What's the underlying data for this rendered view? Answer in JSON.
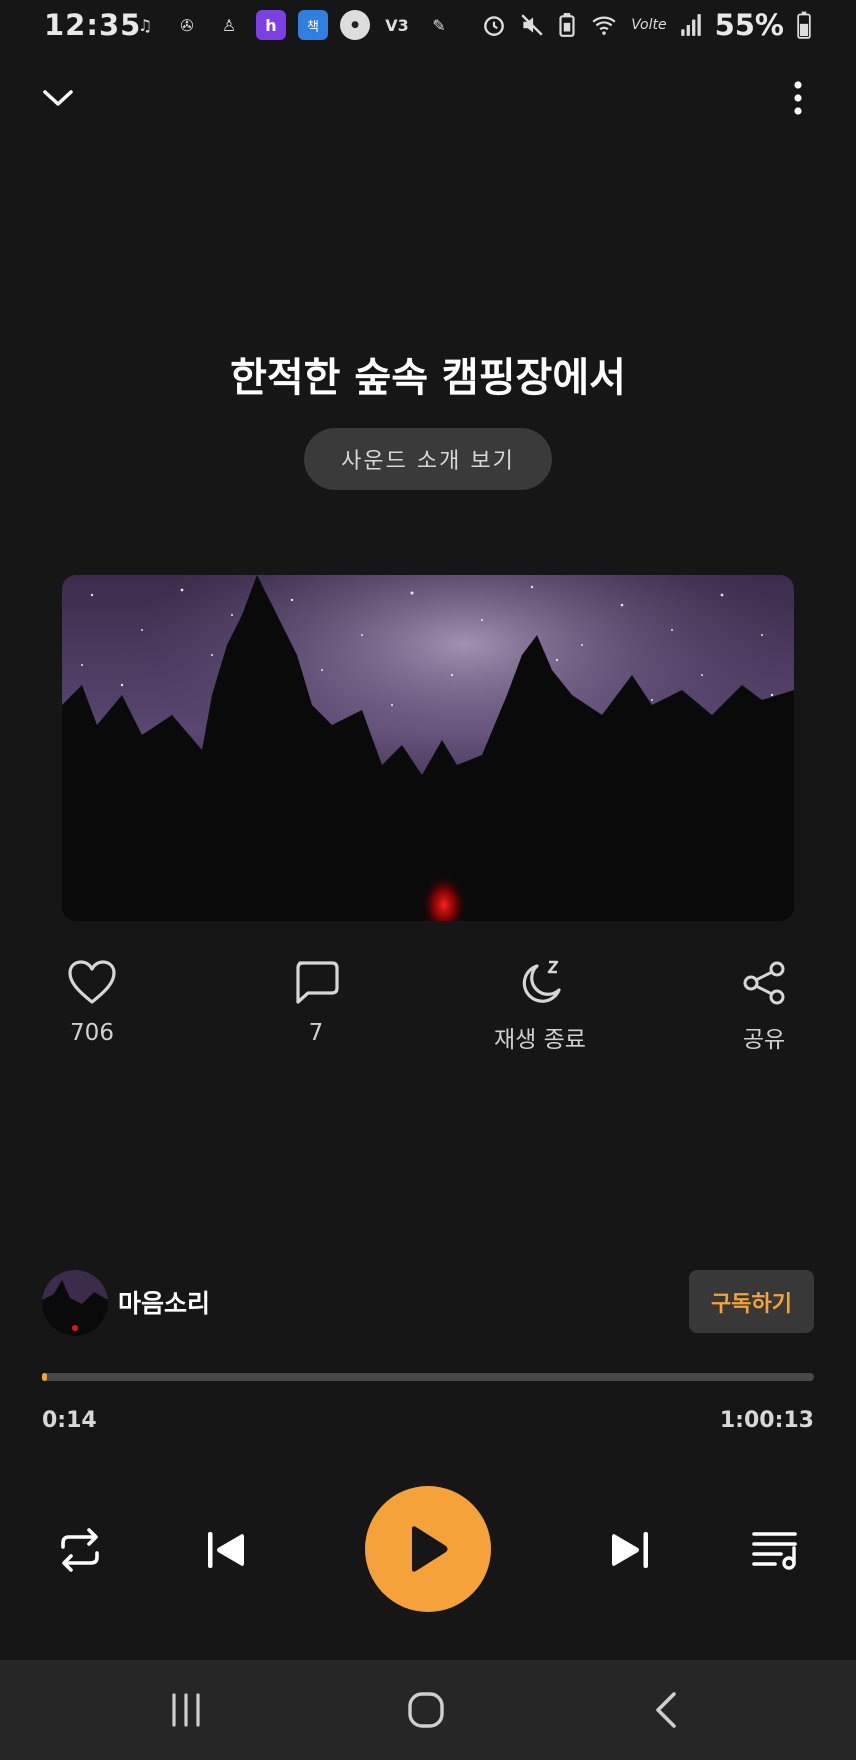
{
  "status_bar": {
    "time": "12:35",
    "notification_icons": [
      "music-note-icon",
      "fan-icon",
      "figure-icon",
      "h-app-icon",
      "book-app-icon",
      "lock-app-icon",
      "v3-app-icon",
      "pen-app-icon"
    ],
    "system_icons": [
      "alarm-icon",
      "mute-icon",
      "battery-saver-icon",
      "wifi-icon",
      "volte-icon",
      "signal-icon"
    ],
    "volte_label": "Volte",
    "battery": "55%"
  },
  "header": {
    "collapse_icon": "chevron-down-icon",
    "menu_icon": "more-vertical-icon"
  },
  "track": {
    "title": "한적한 숲속 캠핑장에서",
    "intro_button_label": "사운드 소개 보기"
  },
  "actions": {
    "like": {
      "icon": "heart-icon",
      "label": "706"
    },
    "comment": {
      "icon": "comment-icon",
      "label": "7"
    },
    "sleep_timer": {
      "icon": "moon-sleep-icon",
      "label": "재생 종료"
    },
    "share": {
      "icon": "share-icon",
      "label": "공유"
    }
  },
  "channel": {
    "name": "마음소리",
    "subscribe_label": "구독하기"
  },
  "player": {
    "current_time": "0:14",
    "total_time": "1:00:13",
    "progress_fraction": 0.004
  },
  "controls": {
    "repeat": "repeat-icon",
    "previous": "skip-previous-icon",
    "play": "play-icon",
    "next": "skip-next-icon",
    "playlist": "playlist-icon"
  },
  "nav_bar": {
    "recents": "recents-icon",
    "home": "home-icon",
    "back": "back-icon"
  },
  "colors": {
    "background": "#161616",
    "accent": "#f5a23a",
    "button_bg": "#3a3a3a",
    "progress_track": "#484848"
  }
}
